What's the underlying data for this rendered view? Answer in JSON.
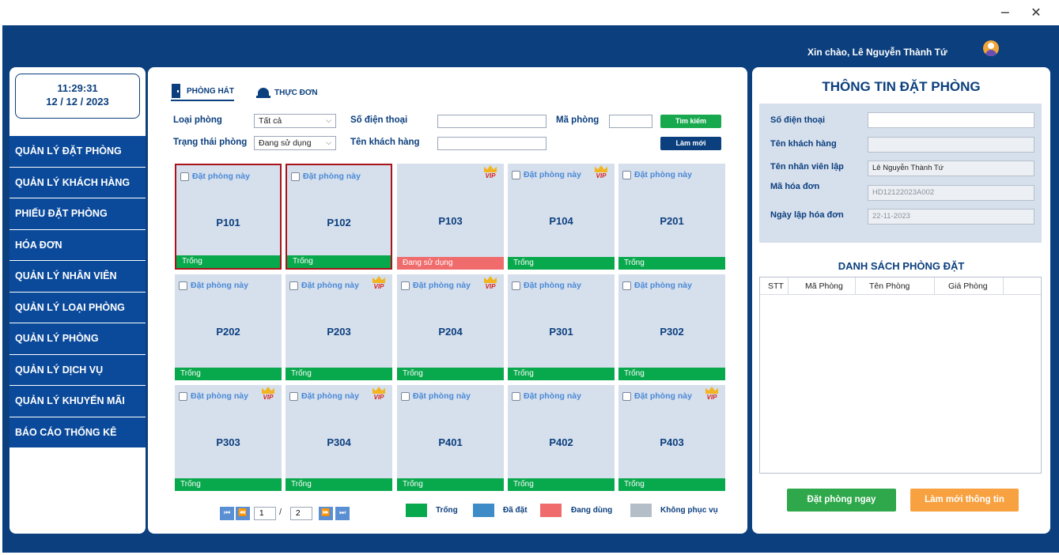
{
  "window": {
    "minimize": "−",
    "close": "✕"
  },
  "header": {
    "greeting": "Xin chào,  Lê Nguyễn Thành Tứ",
    "avatar_icon": "user-avatar-icon"
  },
  "sidebar": {
    "time": "11:29:31",
    "date": "12 / 12 / 2023",
    "items": [
      "QUẢN LÝ ĐẶT PHÒNG",
      "QUẢN LÝ KHÁCH HÀNG",
      "PHIẾU ĐẶT PHÒNG",
      "HÓA ĐƠN",
      "QUẢN LÝ NHÂN VIÊN",
      "QUẢN LÝ LOẠI PHÒNG",
      "QUẢN LÝ PHÒNG",
      "QUẢN LÝ DỊCH VỤ",
      "QUẢN LÝ KHUYẾN MÃI",
      "BÁO CÁO THỐNG KÊ"
    ]
  },
  "tabs": {
    "rooms": "PHÒNG HÁT",
    "menu": "THỰC ĐƠN"
  },
  "filters": {
    "room_type_label": "Loại phòng",
    "room_type_value": "Tất cả",
    "room_status_label": "Trạng thái phòng",
    "room_status_value": "Đang sử dụng",
    "phone_label": "Số điện thoại",
    "phone_value": "",
    "customer_label": "Tên khách hàng",
    "customer_value": "",
    "room_code_label": "Mã phòng",
    "room_code_value": "",
    "search_button": "Tìm kiếm",
    "refresh_button": "Làm mới"
  },
  "rooms": {
    "check_label": "Đặt phòng này",
    "vip_label": "VIP",
    "items": [
      {
        "code": "P101",
        "status": "Trống",
        "vip": false,
        "selected": true,
        "show_check": true
      },
      {
        "code": "P102",
        "status": "Trống",
        "vip": false,
        "selected": true,
        "show_check": true
      },
      {
        "code": "P103",
        "status": "Đang sử dụng",
        "vip": true,
        "selected": false,
        "show_check": false
      },
      {
        "code": "P104",
        "status": "Trống",
        "vip": true,
        "selected": false,
        "show_check": true
      },
      {
        "code": "P201",
        "status": "Trống",
        "vip": false,
        "selected": false,
        "show_check": true
      },
      {
        "code": "P202",
        "status": "Trống",
        "vip": false,
        "selected": false,
        "show_check": true
      },
      {
        "code": "P203",
        "status": "Trống",
        "vip": true,
        "selected": false,
        "show_check": true
      },
      {
        "code": "P204",
        "status": "Trống",
        "vip": true,
        "selected": false,
        "show_check": true
      },
      {
        "code": "P301",
        "status": "Trống",
        "vip": false,
        "selected": false,
        "show_check": true
      },
      {
        "code": "P302",
        "status": "Trống",
        "vip": false,
        "selected": false,
        "show_check": true
      },
      {
        "code": "P303",
        "status": "Trống",
        "vip": true,
        "selected": false,
        "show_check": true
      },
      {
        "code": "P304",
        "status": "Trống",
        "vip": true,
        "selected": false,
        "show_check": true
      },
      {
        "code": "P401",
        "status": "Trống",
        "vip": false,
        "selected": false,
        "show_check": true
      },
      {
        "code": "P402",
        "status": "Trống",
        "vip": false,
        "selected": false,
        "show_check": true
      },
      {
        "code": "P403",
        "status": "Trống",
        "vip": true,
        "selected": false,
        "show_check": true
      }
    ]
  },
  "pager": {
    "current": "1",
    "separator": "/",
    "total": "2"
  },
  "legend": [
    {
      "label": "Trống",
      "color": "#08a84c"
    },
    {
      "label": "Đã đặt",
      "color": "#3d8cc8"
    },
    {
      "label": "Đang dùng",
      "color": "#f06b6b"
    },
    {
      "label": "Không phục vụ",
      "color": "#b3bec8"
    }
  ],
  "booking": {
    "title": "THÔNG TIN ĐẶT PHÒNG",
    "phone_label": "Số điện thoại",
    "phone_value": "",
    "customer_label": "Tên khách hàng",
    "customer_value": "",
    "staff_label": "Tên nhân viên lập",
    "staff_value": "Lê Nguyễn Thành Tứ",
    "invoice_label": "Mã hóa đơn",
    "invoice_value": "HD12122023A002",
    "date_label": "Ngày lập hóa đơn",
    "date_value": "22-11-2023",
    "list_title": "DANH SÁCH PHÒNG ĐẶT",
    "columns": [
      "STT",
      "Mã Phòng",
      "Tên Phòng",
      "Giá Phòng"
    ],
    "book_button": "Đặt phòng ngay",
    "reset_button": "Làm mới thông tin"
  },
  "colors": {
    "navy": "#0b3f7e",
    "menu_blue": "#0b4a9b",
    "available": "#08a84c",
    "in_use": "#f06b6b",
    "search_green": "#18a94f",
    "book_green": "#2ea84a",
    "reset_orange": "#f7a140"
  }
}
